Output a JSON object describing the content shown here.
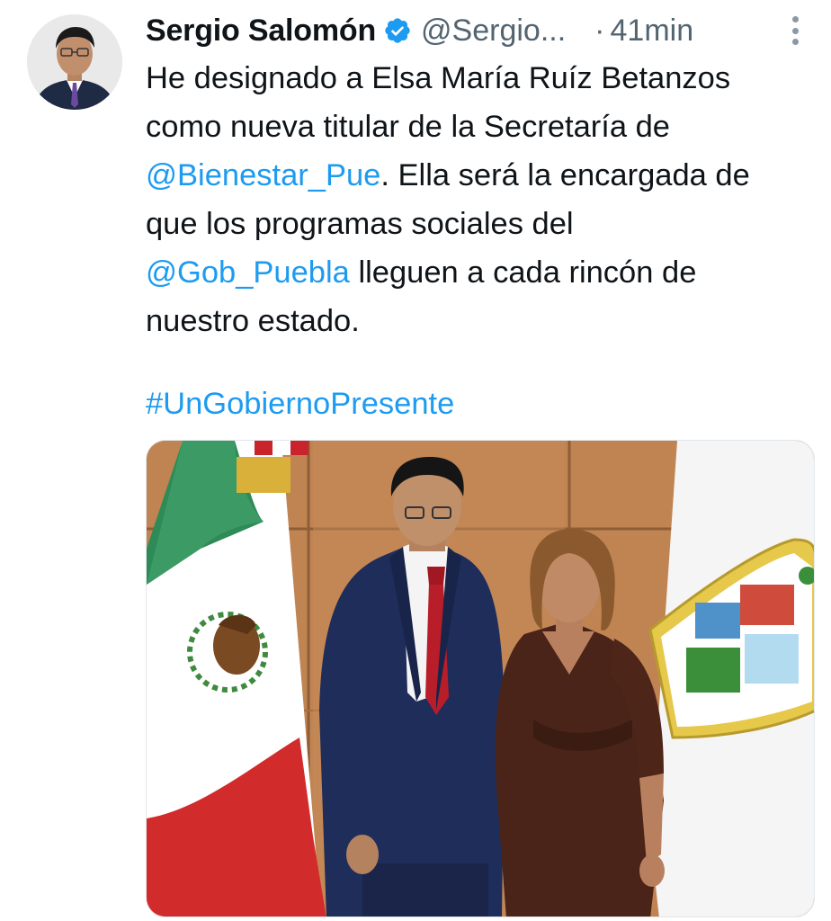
{
  "author": {
    "display_name": "Sergio Salomón",
    "handle": "@Sergio...",
    "separator": "·",
    "time": "41min",
    "verified_icon": "verified-badge-icon",
    "verified_color": "#1d9bf0"
  },
  "tweet": {
    "lines": [
      [
        {
          "text": "He designado a Elsa María Ruíz Betanzos",
          "kind": "text"
        }
      ],
      [
        {
          "text": "como nueva titular de la Secretaría de",
          "kind": "text"
        }
      ],
      [
        {
          "text": "@Bienestar_Pue",
          "kind": "mention"
        },
        {
          "text": ". Ella será la encargada de",
          "kind": "text"
        }
      ],
      [
        {
          "text": "que los programas sociales del",
          "kind": "text"
        }
      ],
      [
        {
          "text": "@Gob_Puebla",
          "kind": "mention"
        },
        {
          "text": " lleguen a cada rincón de",
          "kind": "text"
        }
      ],
      [
        {
          "text": "nuestro estado.",
          "kind": "text"
        }
      ]
    ],
    "hashtag": "#UnGobiernoPresente",
    "link_color": "#1d9bf0"
  },
  "media": {
    "type": "photo",
    "alt": ""
  },
  "icons": {
    "more": "more-options-icon"
  }
}
